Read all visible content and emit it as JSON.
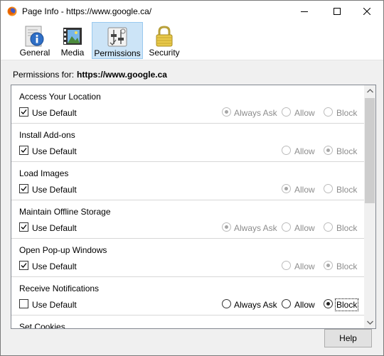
{
  "window": {
    "title": "Page Info - https://www.google.ca/",
    "controls": [
      "minimize-icon",
      "maximize-icon",
      "close-icon"
    ]
  },
  "tabs": [
    {
      "label": "General",
      "icon": "info-icon"
    },
    {
      "label": "Media",
      "icon": "media-icon"
    },
    {
      "label": "Permissions",
      "icon": "permissions-icon",
      "active": true
    },
    {
      "label": "Security",
      "icon": "lock-icon"
    }
  ],
  "permissions_for": {
    "label": "Permissions for:",
    "site": "https://www.google.ca"
  },
  "permissions": [
    {
      "title": "Access Your Location",
      "use_default_label": "Use Default",
      "use_default": true,
      "options": {
        "always_ask": "Always Ask",
        "allow": "Allow",
        "block": "Block"
      },
      "selected": "always_ask"
    },
    {
      "title": "Install Add-ons",
      "use_default_label": "Use Default",
      "use_default": true,
      "options": {
        "allow": "Allow",
        "block": "Block"
      },
      "selected": "block"
    },
    {
      "title": "Load Images",
      "use_default_label": "Use Default",
      "use_default": true,
      "options": {
        "allow": "Allow",
        "block": "Block"
      },
      "selected": "allow"
    },
    {
      "title": "Maintain Offline Storage",
      "use_default_label": "Use Default",
      "use_default": true,
      "options": {
        "always_ask": "Always Ask",
        "allow": "Allow",
        "block": "Block"
      },
      "selected": "always_ask"
    },
    {
      "title": "Open Pop-up Windows",
      "use_default_label": "Use Default",
      "use_default": true,
      "options": {
        "allow": "Allow",
        "block": "Block"
      },
      "selected": "block"
    },
    {
      "title": "Receive Notifications",
      "use_default_label": "Use Default",
      "use_default": false,
      "options": {
        "always_ask": "Always Ask",
        "allow": "Allow",
        "block": "Block"
      },
      "selected": "block"
    },
    {
      "title": "Set Cookies"
    }
  ],
  "help_label": "Help",
  "colors": {
    "active_tab": "#cce4f7",
    "active_tab_border": "#99c9ef",
    "disabled_text": "#8d8d8d"
  }
}
